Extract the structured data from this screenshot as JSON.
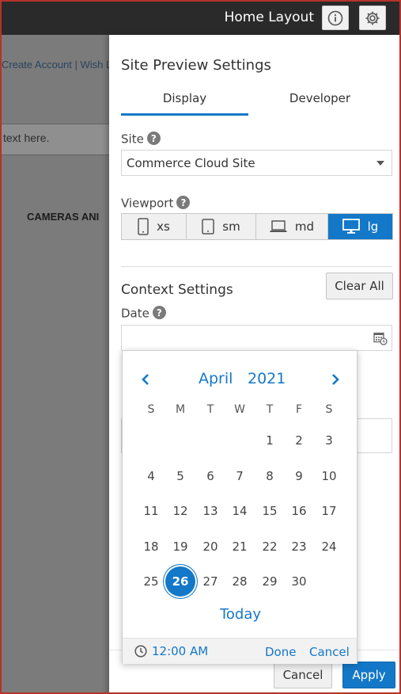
{
  "header": {
    "title": "Home Layout",
    "info_icon": "info-circle-icon",
    "settings_icon": "gear-icon"
  },
  "background": {
    "account_links": "Create Account | Wish Li",
    "search_placeholder": "text here.",
    "category_heading": "CAMERAS ANI"
  },
  "panel": {
    "title": "Site Preview Settings",
    "tabs": [
      {
        "label": "Display",
        "active": true
      },
      {
        "label": "Developer",
        "active": false
      }
    ],
    "site_label": "Site",
    "site_value": "Commerce Cloud Site",
    "viewport_label": "Viewport",
    "viewports": [
      {
        "label": "xs",
        "icon": "phone-icon",
        "active": false
      },
      {
        "label": "sm",
        "icon": "tablet-icon",
        "active": false
      },
      {
        "label": "md",
        "icon": "laptop-icon",
        "active": false
      },
      {
        "label": "lg",
        "icon": "desktop-icon",
        "active": true
      }
    ],
    "context_title": "Context Settings",
    "clear_all_label": "Clear All",
    "date_label": "Date",
    "date_value": "",
    "help_glyph": "?"
  },
  "calendar": {
    "month": "April",
    "year": "2021",
    "weekdays": [
      "S",
      "M",
      "T",
      "W",
      "T",
      "F",
      "S"
    ],
    "weeks": [
      [
        "",
        "",
        "",
        "",
        "1",
        "2",
        "3"
      ],
      [
        "4",
        "5",
        "6",
        "7",
        "8",
        "9",
        "10"
      ],
      [
        "11",
        "12",
        "13",
        "14",
        "15",
        "16",
        "17"
      ],
      [
        "18",
        "19",
        "20",
        "21",
        "22",
        "23",
        "24"
      ],
      [
        "25",
        "26",
        "27",
        "28",
        "29",
        "30",
        ""
      ]
    ],
    "selected_day": "26",
    "today_label": "Today",
    "time": "12:00 AM",
    "done_label": "Done",
    "cancel_label": "Cancel"
  },
  "footer": {
    "cancel_label": "Cancel",
    "apply_label": "Apply"
  },
  "colors": {
    "accent": "#1478c8",
    "header_bg": "#2a2a2a",
    "frame_border": "#b5332a"
  }
}
